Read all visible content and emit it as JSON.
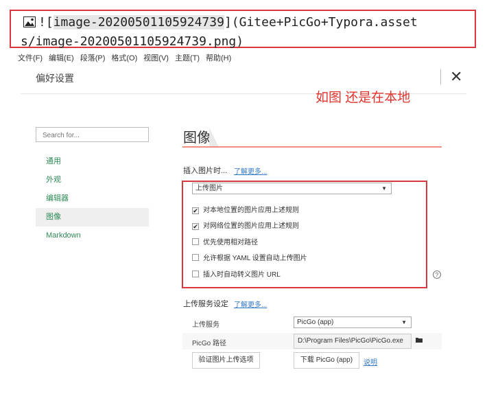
{
  "snippet": {
    "line1_prefix": "![",
    "line1_selected": "image-20200501105924739",
    "line1_suffix": "](Gitee+PicGo+Typora.asset",
    "line2": "s/image-20200501105924739.png)"
  },
  "menubar": [
    "文件(F)",
    "编辑(E)",
    "段落(P)",
    "格式(O)",
    "视图(V)",
    "主题(T)",
    "帮助(H)"
  ],
  "header": {
    "title": "偏好设置",
    "close": "✕"
  },
  "annotation": "如图 还是在本地",
  "sidebar": {
    "search_placeholder": "Search for...",
    "items": [
      {
        "label": "通用"
      },
      {
        "label": "外观"
      },
      {
        "label": "编辑器"
      },
      {
        "label": "图像",
        "active": true
      },
      {
        "label": "Markdown"
      }
    ]
  },
  "main": {
    "title": "图像",
    "insert": {
      "label": "插入图片时...",
      "learn_more": "了解更多...",
      "select_value": "上传图片",
      "options": [
        {
          "label": "对本地位置的图片应用上述规则",
          "checked": true
        },
        {
          "label": "对网络位置的图片应用上述规则",
          "checked": true
        },
        {
          "label": "优先使用相对路径",
          "checked": false
        },
        {
          "label": "允许根据 YAML 设置自动上传图片",
          "checked": false
        },
        {
          "label": "插入时自动转义图片 URL",
          "checked": false
        }
      ],
      "help": "?"
    },
    "upload": {
      "label": "上传服务设定",
      "learn_more": "了解更多...",
      "service_label": "上传服务",
      "service_value": "PicGo (app)",
      "path_label": "PicGo 路径",
      "path_value": "D:\\Program Files\\PicGo\\PicGo.exe",
      "verify_button": "验证图片上传选项",
      "download_button": "下载 PicGo (app)",
      "explain_link": "说明"
    }
  }
}
